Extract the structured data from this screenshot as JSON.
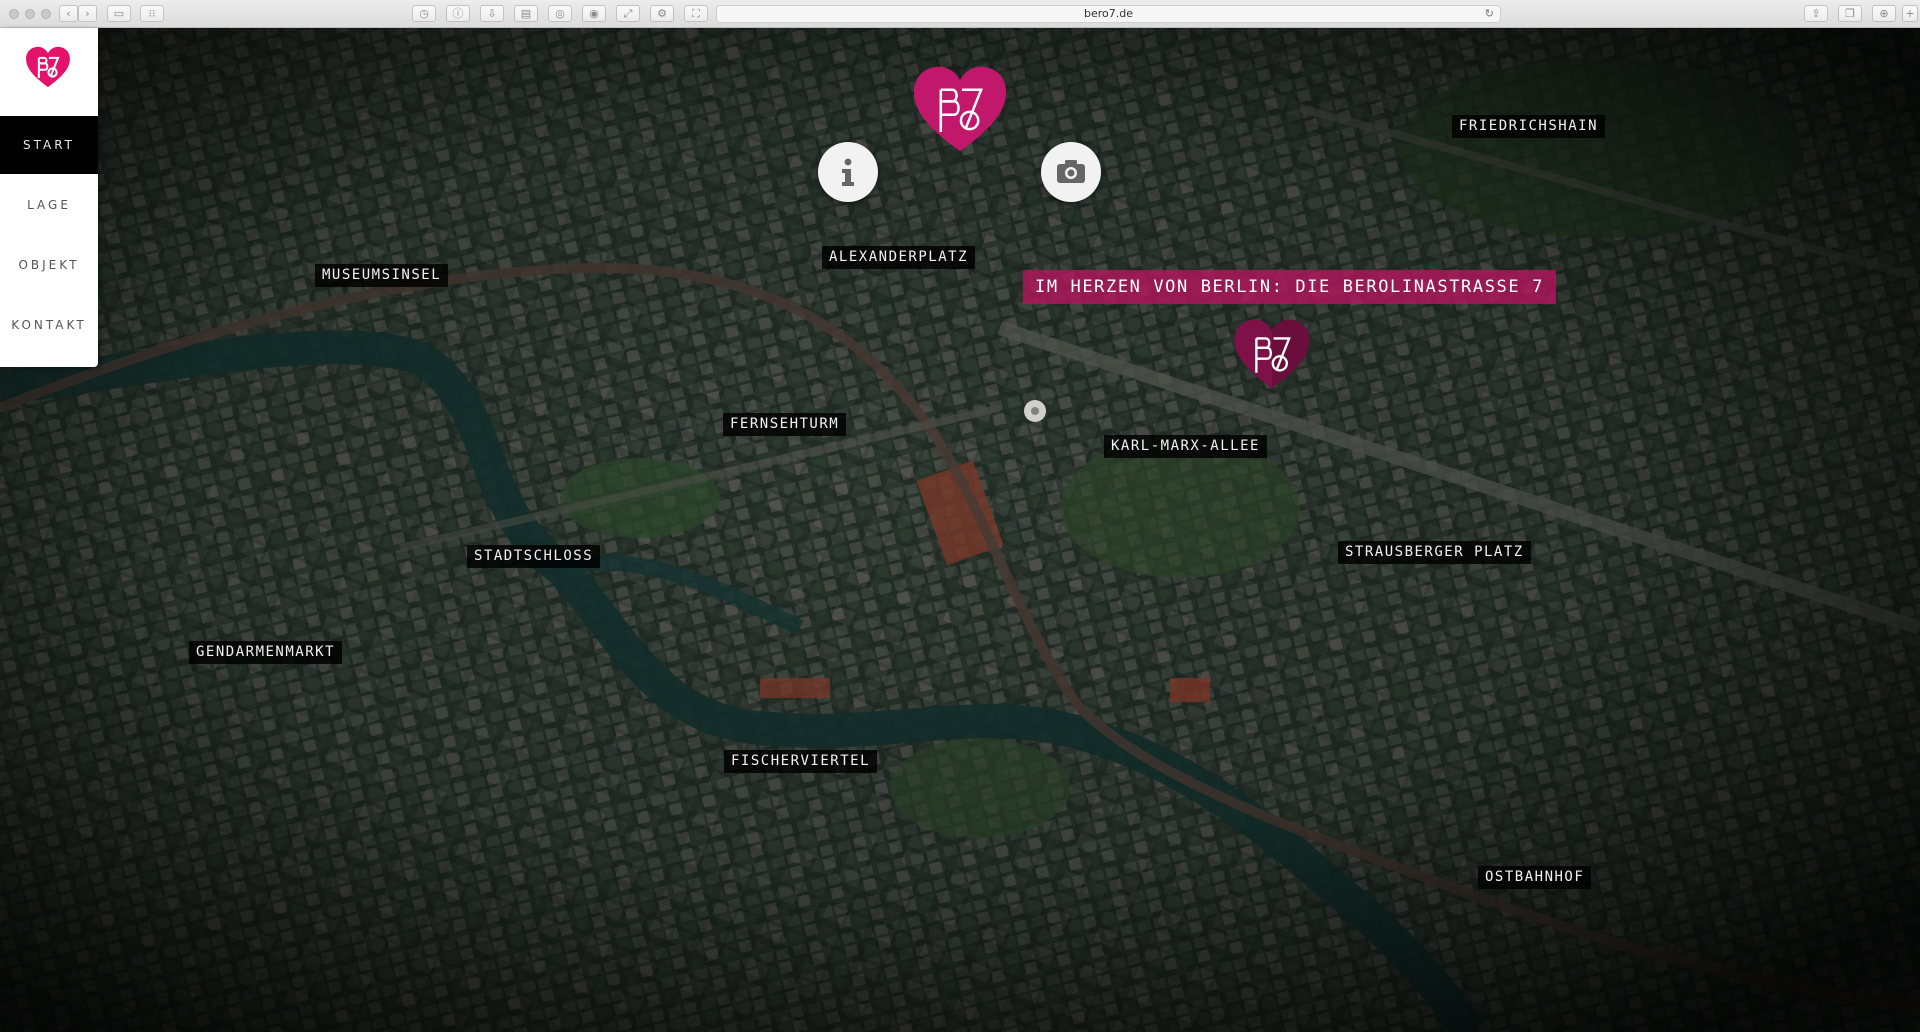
{
  "browser": {
    "url": "bero7.de"
  },
  "nav": {
    "items": [
      {
        "label": "START",
        "active": true
      },
      {
        "label": "LAGE",
        "active": false
      },
      {
        "label": "OBJEKT",
        "active": false
      },
      {
        "label": "KONTAKT",
        "active": false
      }
    ]
  },
  "map": {
    "headline": "IM HERZEN VON BERLIN: DIE BEROLINASTRASSE 7",
    "labels": {
      "alexanderplatz": "ALEXANDERPLATZ",
      "museumsinsel": "MUSEUMSINSEL",
      "fernsehturm": "FERNSEHTURM",
      "karl_marx_allee": "KARL-MARX-ALLEE",
      "stadtschloss": "STADTSCHLOSS",
      "strausberger_platz": "STRAUSBERGER PLATZ",
      "gendarmenmarkt": "GENDARMENMARKT",
      "fischerviertel": "FISCHERVIERTEL",
      "friedrichshain": "FRIEDRICHSHAIN",
      "ostbahnhof": "OSTBAHNHOF"
    }
  },
  "colors": {
    "brand": "#c2186b",
    "brand_dark": "#6a0e3c"
  },
  "icons": {
    "info": "info-icon",
    "camera": "camera-icon",
    "logo": "bero7-heart-logo"
  }
}
